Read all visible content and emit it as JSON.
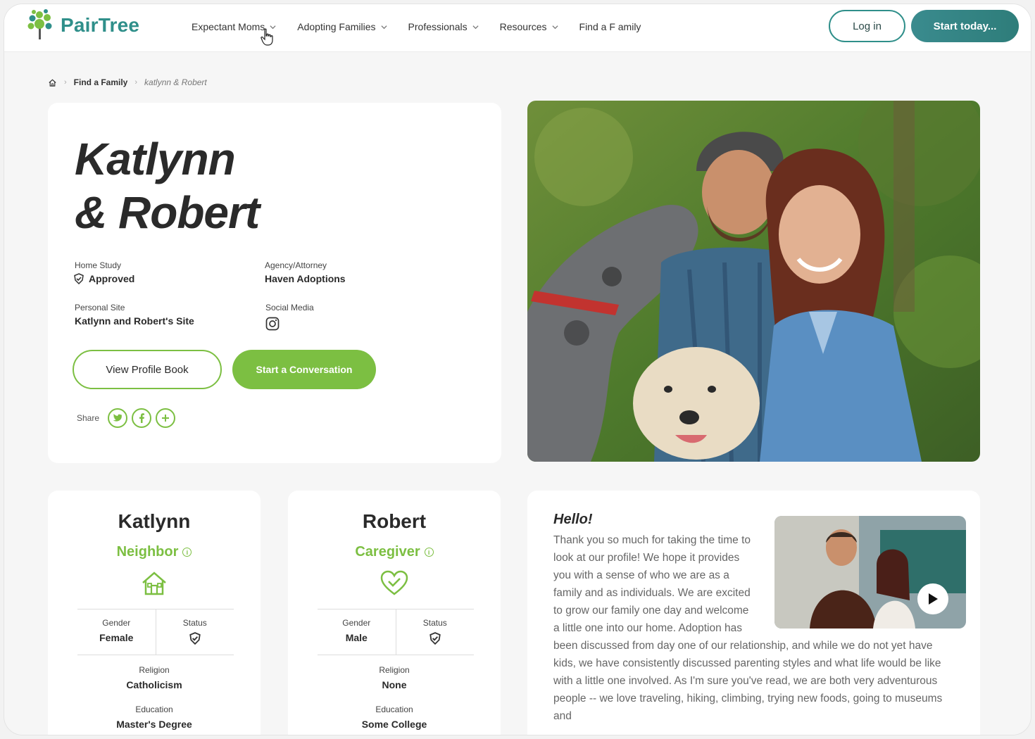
{
  "brand": {
    "name": "PairTree",
    "color": "#2f8f8a",
    "accent": "#7cbf42"
  },
  "nav": {
    "items": [
      {
        "label": "Expectant Moms"
      },
      {
        "label": "Adopting Families"
      },
      {
        "label": "Professionals"
      },
      {
        "label": "Resources"
      },
      {
        "label": "Find a F amily"
      }
    ],
    "login_label": "Log in",
    "start_label": "Start today..."
  },
  "breadcrumb": {
    "level1": "Find a Family",
    "current": "katlynn & Robert"
  },
  "profile": {
    "name_line1": "Katlynn",
    "name_line2": "& Robert",
    "home_study_label": "Home Study",
    "home_study_value": "Approved",
    "agency_label": "Agency/Attorney",
    "agency_value": "Haven Adoptions",
    "site_label": "Personal Site",
    "site_value": "Katlynn and Robert's Site",
    "social_label": "Social Media",
    "view_book_label": "View Profile Book",
    "conversation_label": "Start a Conversation",
    "share_label": "Share"
  },
  "people": [
    {
      "name": "Katlynn",
      "role": "Neighbor",
      "gender_label": "Gender",
      "gender": "Female",
      "status_label": "Status",
      "religion_label": "Religion",
      "religion": "Catholicism",
      "education_label": "Education",
      "education": "Master's Degree"
    },
    {
      "name": "Robert",
      "role": "Caregiver",
      "gender_label": "Gender",
      "gender": "Male",
      "status_label": "Status",
      "religion_label": "Religion",
      "religion": "None",
      "education_label": "Education",
      "education": "Some College"
    }
  ],
  "hello": {
    "title": "Hello!",
    "body": "Thank you so much for taking the time to look at our profile! We hope it provides you with a sense of who we are as a family and as individuals. We are excited to grow our family one day and welcome a little one into our home. Adoption has been discussed from day one of our relationship, and while we do not yet have kids, we have consistently discussed parenting styles and what life would be like with a little one involved. As I'm sure you've read, we are both very adventurous people -- we love traveling, hiking, climbing, trying new foods, going to museums and"
  }
}
